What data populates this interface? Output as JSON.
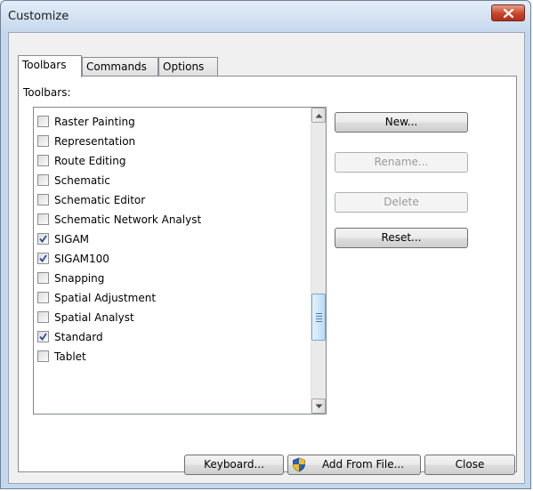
{
  "window": {
    "title": "Customize"
  },
  "tabs": [
    {
      "label": "Toolbars",
      "active": true
    },
    {
      "label": "Commands",
      "active": false
    },
    {
      "label": "Options",
      "active": false
    }
  ],
  "toolbars_label": "Toolbars:",
  "toolbars_list": [
    {
      "label": "Raster Painting",
      "checked": false
    },
    {
      "label": "Representation",
      "checked": false
    },
    {
      "label": "Route Editing",
      "checked": false
    },
    {
      "label": "Schematic",
      "checked": false
    },
    {
      "label": "Schematic Editor",
      "checked": false
    },
    {
      "label": "Schematic Network Analyst",
      "checked": false
    },
    {
      "label": "SIGAM",
      "checked": true
    },
    {
      "label": "SIGAM100",
      "checked": true
    },
    {
      "label": "Snapping",
      "checked": false
    },
    {
      "label": "Spatial Adjustment",
      "checked": false
    },
    {
      "label": "Spatial Analyst",
      "checked": false
    },
    {
      "label": "Standard",
      "checked": true
    },
    {
      "label": "Tablet",
      "checked": false
    }
  ],
  "side_buttons": {
    "new": {
      "label": "New...",
      "enabled": true
    },
    "rename": {
      "label": "Rename...",
      "enabled": false
    },
    "delete": {
      "label": "Delete",
      "enabled": false
    },
    "reset": {
      "label": "Reset...",
      "enabled": true
    }
  },
  "footer": {
    "keyboard": "Keyboard...",
    "add_from_file": "Add From File...",
    "close": "Close"
  },
  "icons": {
    "close": "close-x-icon",
    "shield": "uac-shield-icon",
    "scroll_up": "scroll-up-arrow-icon",
    "scroll_down": "scroll-down-arrow-icon",
    "checkmark": "checkmark-icon"
  },
  "colors": {
    "frame": "#c5d7ec",
    "close_button": "#c9432a",
    "check": "#2a4a9a"
  }
}
